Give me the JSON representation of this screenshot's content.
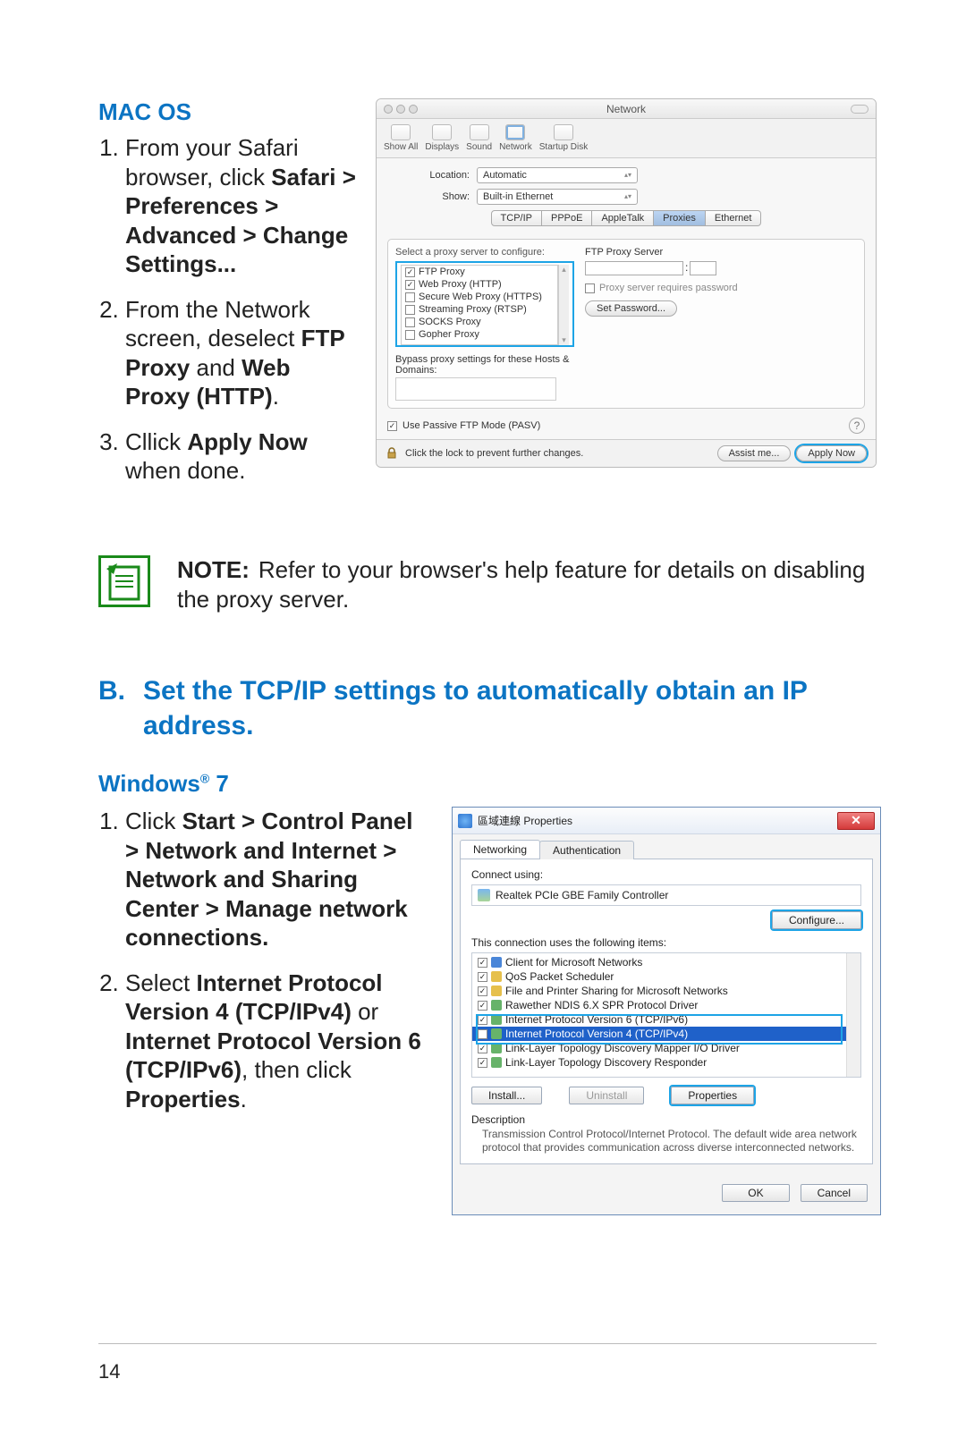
{
  "macos": {
    "heading": "MAC OS",
    "steps": {
      "s1_a": "From your Safari browser, click ",
      "s1_b": "Safari > Preferences > Advanced > Change Settings...",
      "s2_a": "From the Network screen, deselect ",
      "s2_b": "FTP Proxy",
      "s2_c": " and ",
      "s2_d": "Web Proxy (HTTP)",
      "s2_e": ".",
      "s3_a": "Cllick ",
      "s3_b": "Apply Now",
      "s3_c": " when done."
    },
    "window": {
      "title": "Network",
      "toolbar": {
        "show_all": "Show All",
        "displays": "Displays",
        "sound": "Sound",
        "network": "Network",
        "startup": "Startup Disk"
      },
      "location_label": "Location:",
      "location_value": "Automatic",
      "show_label": "Show:",
      "show_value": "Built-in Ethernet",
      "tabs": [
        "TCP/IP",
        "PPPoE",
        "AppleTalk",
        "Proxies",
        "Ethernet"
      ],
      "select_label": "Select a proxy server to configure:",
      "proxies": [
        {
          "label": "FTP Proxy",
          "checked": true
        },
        {
          "label": "Web Proxy (HTTP)",
          "checked": true
        },
        {
          "label": "Secure Web Proxy (HTTPS)",
          "checked": false
        },
        {
          "label": "Streaming Proxy (RTSP)",
          "checked": false
        },
        {
          "label": "SOCKS Proxy",
          "checked": false
        },
        {
          "label": "Gopher Proxy",
          "checked": false
        }
      ],
      "server_label": "FTP Proxy Server",
      "requires_password": "Proxy server requires password",
      "set_password": "Set Password...",
      "bypass_label": "Bypass proxy settings for these Hosts & Domains:",
      "passive": "Use Passive FTP Mode (PASV)",
      "lock_text": "Click the lock to prevent further changes.",
      "assist": "Assist me...",
      "apply": "Apply Now"
    }
  },
  "note": {
    "label": "NOTE:",
    "text": "Refer to your browser's help feature for details on disabling the proxy server."
  },
  "section_b": {
    "letter": "B.",
    "title": "Set the TCP/IP settings to automatically obtain an IP address."
  },
  "windows": {
    "heading": "Windows",
    "heading_sup": "®",
    "heading_ver": " 7",
    "steps": {
      "s1_a": "Click ",
      "s1_b": "Start > Control Panel > Network and Internet > Network and Sharing Center > Manage network connections.",
      "s2_a": "Select ",
      "s2_b": "Internet Protocol Version 4 (TCP/IPv4)",
      "s2_c": " or ",
      "s2_d": "Internet Protocol Version 6 (TCP/IPv6)",
      "s2_e": ", then click ",
      "s2_f": "Properties",
      "s2_g": "."
    },
    "dialog": {
      "title": "區域連線 Properties",
      "tabs": {
        "networking": "Networking",
        "auth": "Authentication"
      },
      "connect_using": "Connect using:",
      "adapter": "Realtek PCIe GBE Family Controller",
      "configure": "Configure...",
      "items_label": "This connection uses the following items:",
      "items": [
        "Client for Microsoft Networks",
        "QoS Packet Scheduler",
        "File and Printer Sharing for Microsoft Networks",
        "Rawether NDIS 6.X SPR Protocol Driver",
        "Internet Protocol Version 6 (TCP/IPv6)",
        "Internet Protocol Version 4 (TCP/IPv4)",
        "Link-Layer Topology Discovery Mapper I/O Driver",
        "Link-Layer Topology Discovery Responder"
      ],
      "install": "Install...",
      "uninstall": "Uninstall",
      "properties": "Properties",
      "description_label": "Description",
      "description": "Transmission Control Protocol/Internet Protocol. The default wide area network protocol that provides communication across diverse interconnected networks.",
      "ok": "OK",
      "cancel": "Cancel"
    }
  },
  "page_number": "14"
}
